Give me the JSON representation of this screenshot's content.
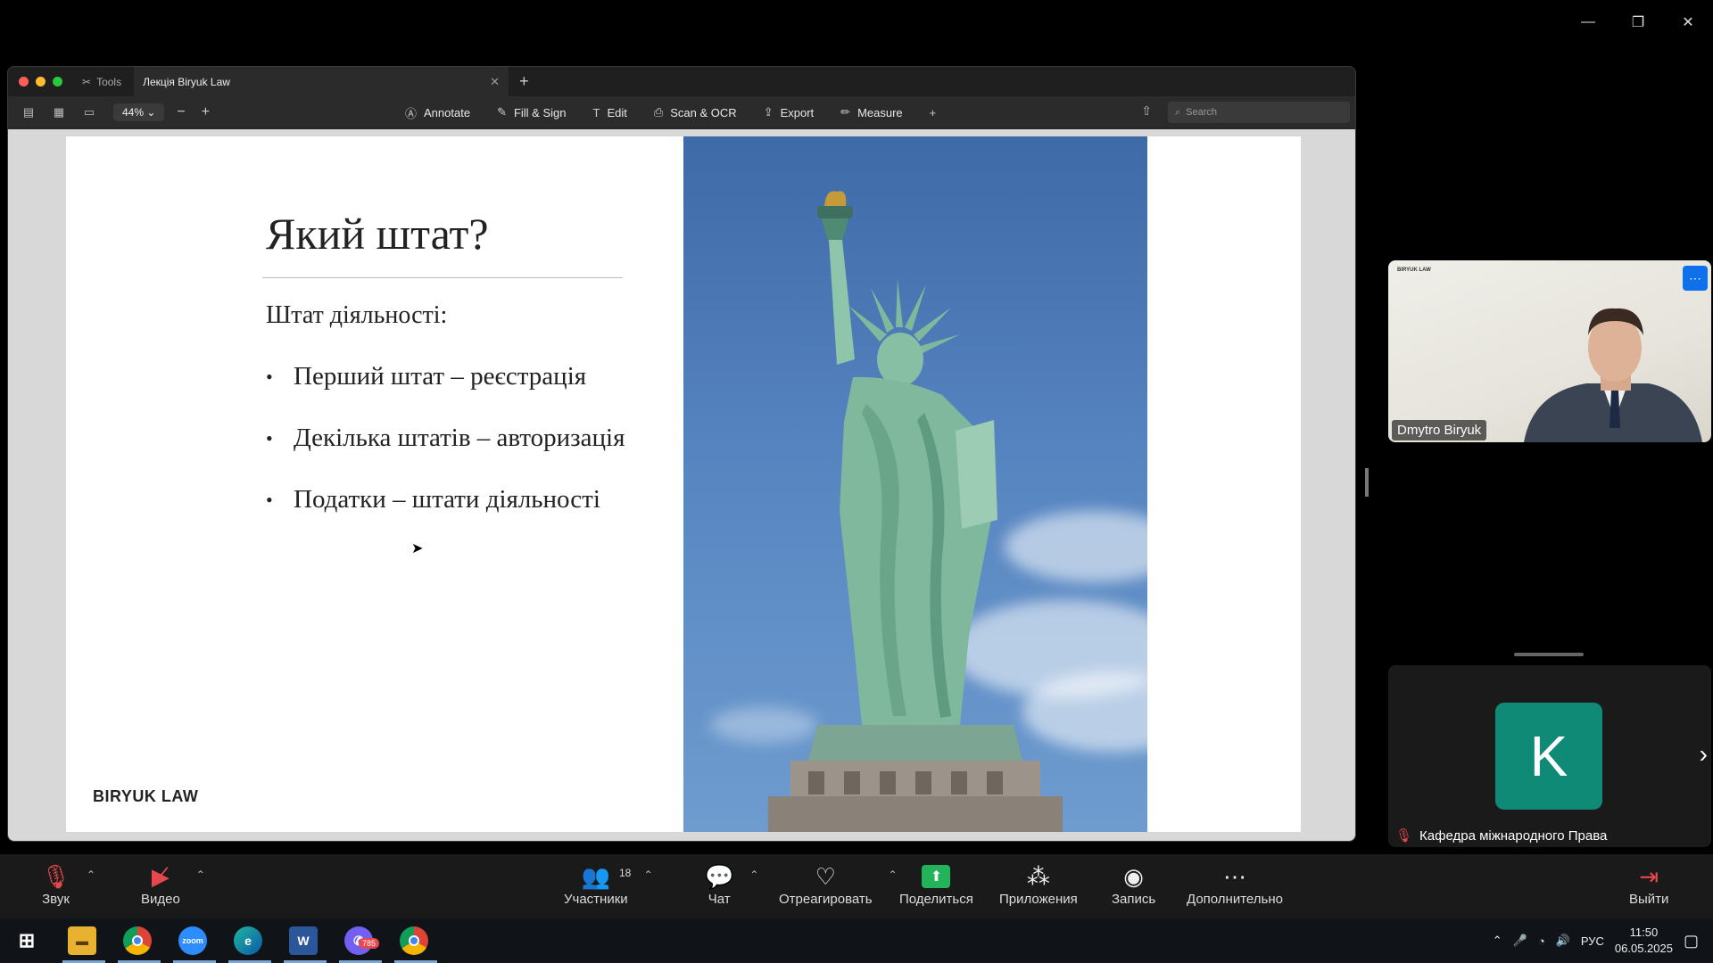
{
  "pdf_app": {
    "tabs": [
      {
        "label": "Tools"
      },
      {
        "label": "Лекція Biryuk Law"
      }
    ],
    "zoom_level": "44%",
    "tools": [
      {
        "label": "Annotate",
        "icon": "annotate-icon"
      },
      {
        "label": "Fill & Sign",
        "icon": "fill-sign-icon"
      },
      {
        "label": "Edit",
        "icon": "edit-icon"
      },
      {
        "label": "Scan & OCR",
        "icon": "scan-icon"
      },
      {
        "label": "Export",
        "icon": "export-icon"
      },
      {
        "label": "Measure",
        "icon": "measure-icon"
      }
    ],
    "search_placeholder": "Search"
  },
  "slide": {
    "title": "Який штат?",
    "subtitle": "Штат діяльності:",
    "bullets": [
      "Перший штат – реєстрація",
      "Декілька штатів – авторизація",
      "Податки – штати діяльності"
    ],
    "brand": "BIRYUK LAW"
  },
  "participants": {
    "speaker_name": "Dmytro Biryuk",
    "speaker_backdrop_brand": "BIRYUK LAW",
    "other_name": "Кафедра міжнародного Права",
    "other_initial": "K"
  },
  "meeting_controls": {
    "audio": "Звук",
    "video": "Видео",
    "participants": "Участники",
    "participants_count": "18",
    "chat": "Чат",
    "react": "Отреагировать",
    "share": "Поделиться",
    "apps": "Приложения",
    "record": "Запись",
    "more": "Дополнительно",
    "leave": "Выйти"
  },
  "taskbar": {
    "viber_badge": "785",
    "zoom_label": "zoom",
    "word_label": "W",
    "language": "РУС",
    "time": "11:50",
    "date": "06.05.2025"
  },
  "colors": {
    "accent_blue": "#0e71eb",
    "share_green": "#22b35b",
    "avatar_teal": "#0e8a77"
  }
}
